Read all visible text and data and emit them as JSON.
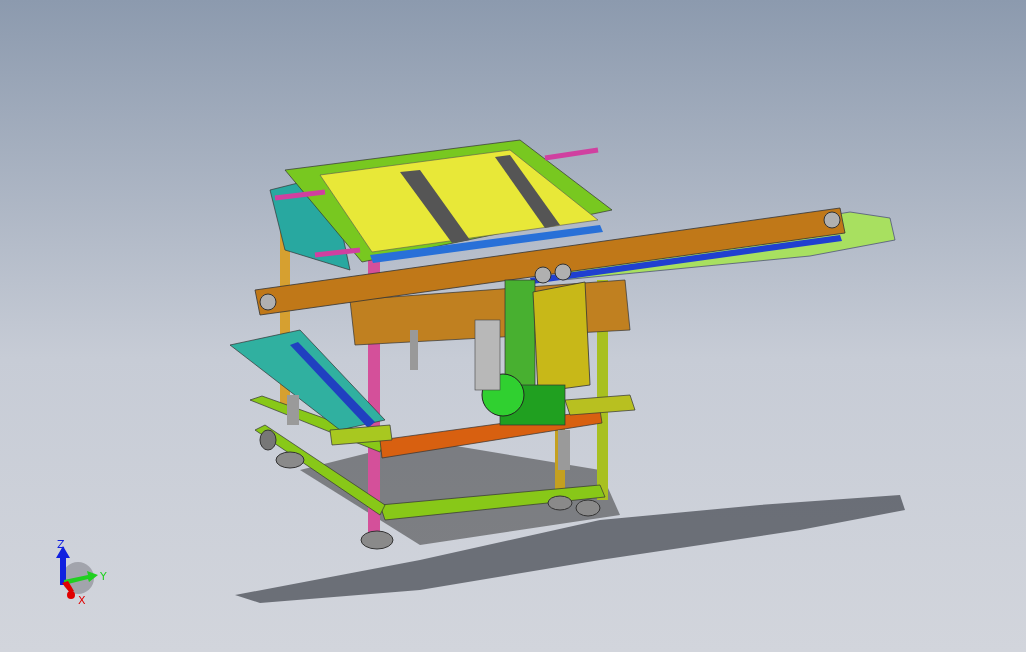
{
  "viewport": {
    "view_triad": {
      "axes": [
        {
          "kind": "z",
          "label": "Z",
          "color": "#1020e0"
        },
        {
          "kind": "y",
          "label": "Y",
          "color": "#20d020"
        },
        {
          "kind": "x",
          "label": "X",
          "color": "#e00000"
        }
      ]
    }
  }
}
